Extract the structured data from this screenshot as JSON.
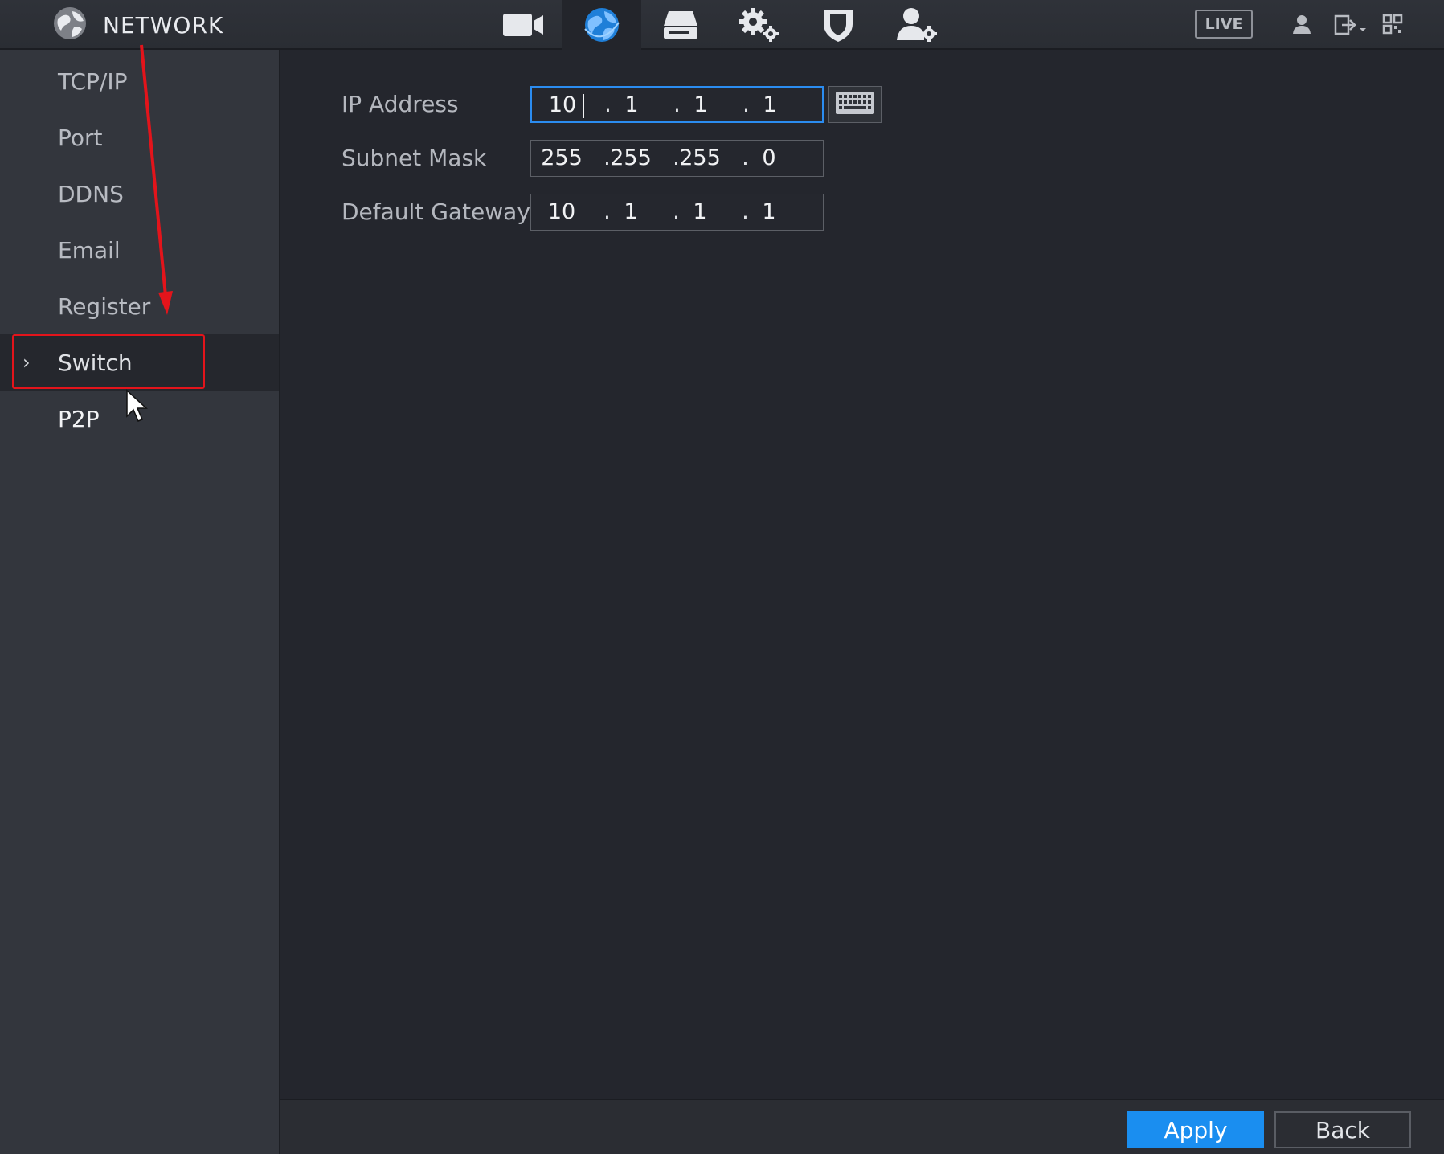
{
  "header": {
    "title": "NETWORK",
    "icons": [
      "globe-logo-icon",
      "camera-icon",
      "network-globe-icon",
      "storage-icon",
      "system-gear-icon",
      "security-shield-icon",
      "account-icon"
    ],
    "live_label": "LIVE"
  },
  "sidebar": {
    "items": [
      {
        "label": "TCP/IP"
      },
      {
        "label": "Port"
      },
      {
        "label": "DDNS"
      },
      {
        "label": "Email"
      },
      {
        "label": "Register"
      },
      {
        "label": "Switch",
        "selected": true
      },
      {
        "label": "P2P"
      }
    ]
  },
  "form": {
    "ip_address": {
      "label": "IP Address",
      "octets": [
        "10",
        "1",
        "1",
        "1"
      ]
    },
    "subnet_mask": {
      "label": "Subnet Mask",
      "octets": [
        "255",
        "255",
        "255",
        "0"
      ]
    },
    "default_gateway": {
      "label": "Default Gateway",
      "octets": [
        "10",
        "1",
        "1",
        "1"
      ]
    }
  },
  "footer": {
    "apply_label": "Apply",
    "back_label": "Back"
  },
  "colors": {
    "accent": "#1a8ef0",
    "annotation": "#e3141b",
    "background": "#24262d",
    "sidebar": "#33363d"
  }
}
